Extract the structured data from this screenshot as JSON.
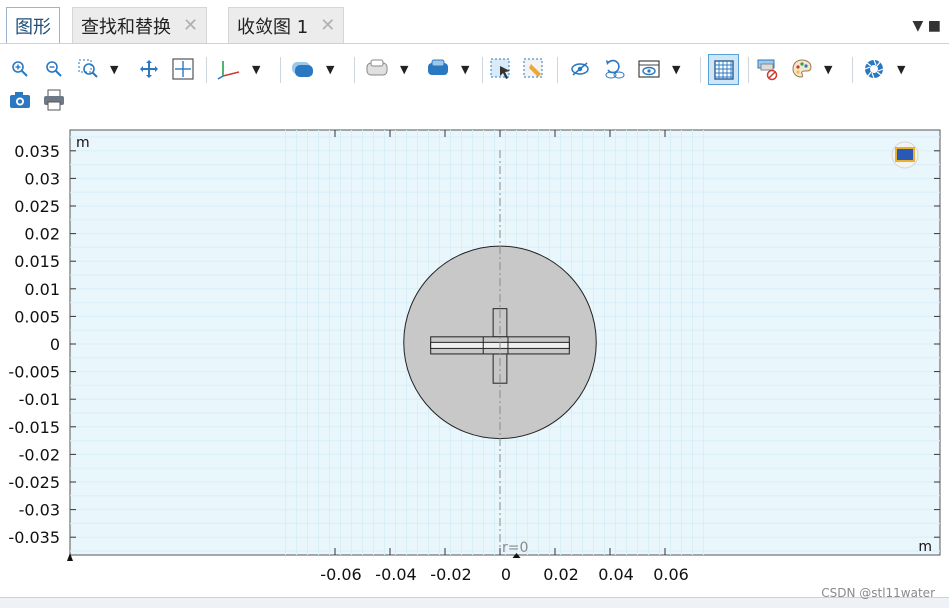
{
  "tabs": [
    {
      "label": "图形",
      "active": true,
      "closable": false
    },
    {
      "label": "查找和替换",
      "active": false,
      "closable": true
    },
    {
      "label": "收敛图 1",
      "active": false,
      "closable": true
    }
  ],
  "tab_close_glyph": "✕",
  "tab_menu_glyph": "▼ ■",
  "toolbar": {
    "icons": [
      "zoom-in-icon",
      "zoom-out-icon",
      "zoom-box-icon",
      "pan-icon",
      "zoom-extents-icon",
      "axis-orientation-icon",
      "scene-light-icon",
      "transparency-icon",
      "select-box-icon",
      "clear-selection-icon",
      "hide-icon",
      "reset-hiding-icon",
      "view-icon",
      "grid-icon",
      "wireframe-icon",
      "color-icon",
      "render-icon",
      "camera-icon",
      "print-icon"
    ],
    "active_icon": "grid-icon",
    "dropdown_glyph": "▼"
  },
  "plot": {
    "y_unit": "m",
    "x_unit": "m",
    "axis_marker": "r=0",
    "y_tick_labels": [
      "0.035",
      "0.03",
      "0.025",
      "0.02",
      "0.015",
      "0.01",
      "0.005",
      "0",
      "-0.005",
      "-0.01",
      "-0.015",
      "-0.02",
      "-0.025",
      "-0.03",
      "-0.035"
    ],
    "x_tick_labels": [
      "-0.06",
      "-0.04",
      "-0.02",
      "0",
      "0.02",
      "0.04",
      "0.06"
    ],
    "colors": {
      "background": "#e9f6fb",
      "grid_major": "#c6e6f4",
      "grid_minor": "#d9eff8",
      "domain_fill": "#c8c8c8",
      "domain_stroke": "#222222",
      "axis_line": "#8a8a8a"
    }
  },
  "watermark": "CSDN @stl11water"
}
